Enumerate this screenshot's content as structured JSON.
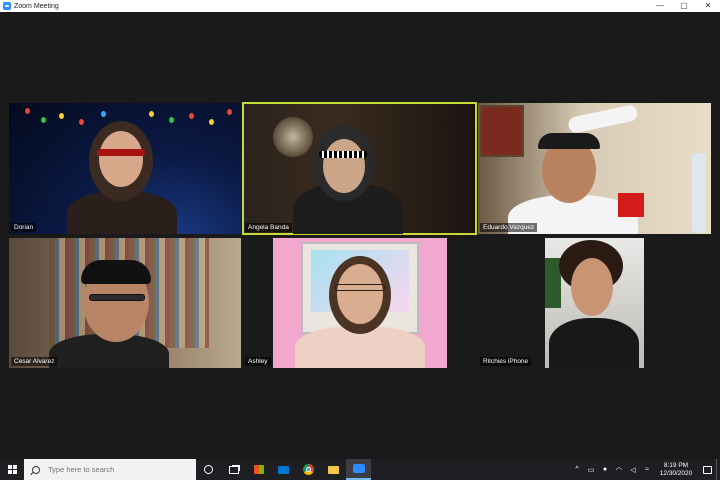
{
  "window": {
    "title": "Zoom Meeting",
    "controls": {
      "minimize": "—",
      "maximize": "▢",
      "close": "✕"
    }
  },
  "participants": [
    {
      "name": "Dorian",
      "active": false
    },
    {
      "name": "Angela Banda",
      "active": true
    },
    {
      "name": "Eduardo Vazquez",
      "active": false
    },
    {
      "name": "Cesar Alvarez",
      "active": false
    },
    {
      "name": "Ashley",
      "active": false
    },
    {
      "name": "Ritchies iPhone",
      "active": false
    }
  ],
  "taskbar": {
    "search_placeholder": "Type here to search",
    "pinned_icons": [
      "cortana-icon",
      "task-view-icon",
      "store-icon",
      "mail-icon",
      "chrome-icon",
      "file-explorer-icon",
      "zoom-icon"
    ],
    "time": "8:19 PM",
    "date": "12/30/2020"
  },
  "colors": {
    "active_speaker_border": "#c6d934",
    "taskbar_bg": "#1d1f23",
    "stage_bg": "#1a1a1a",
    "zoom_blue": "#2d8cff"
  }
}
